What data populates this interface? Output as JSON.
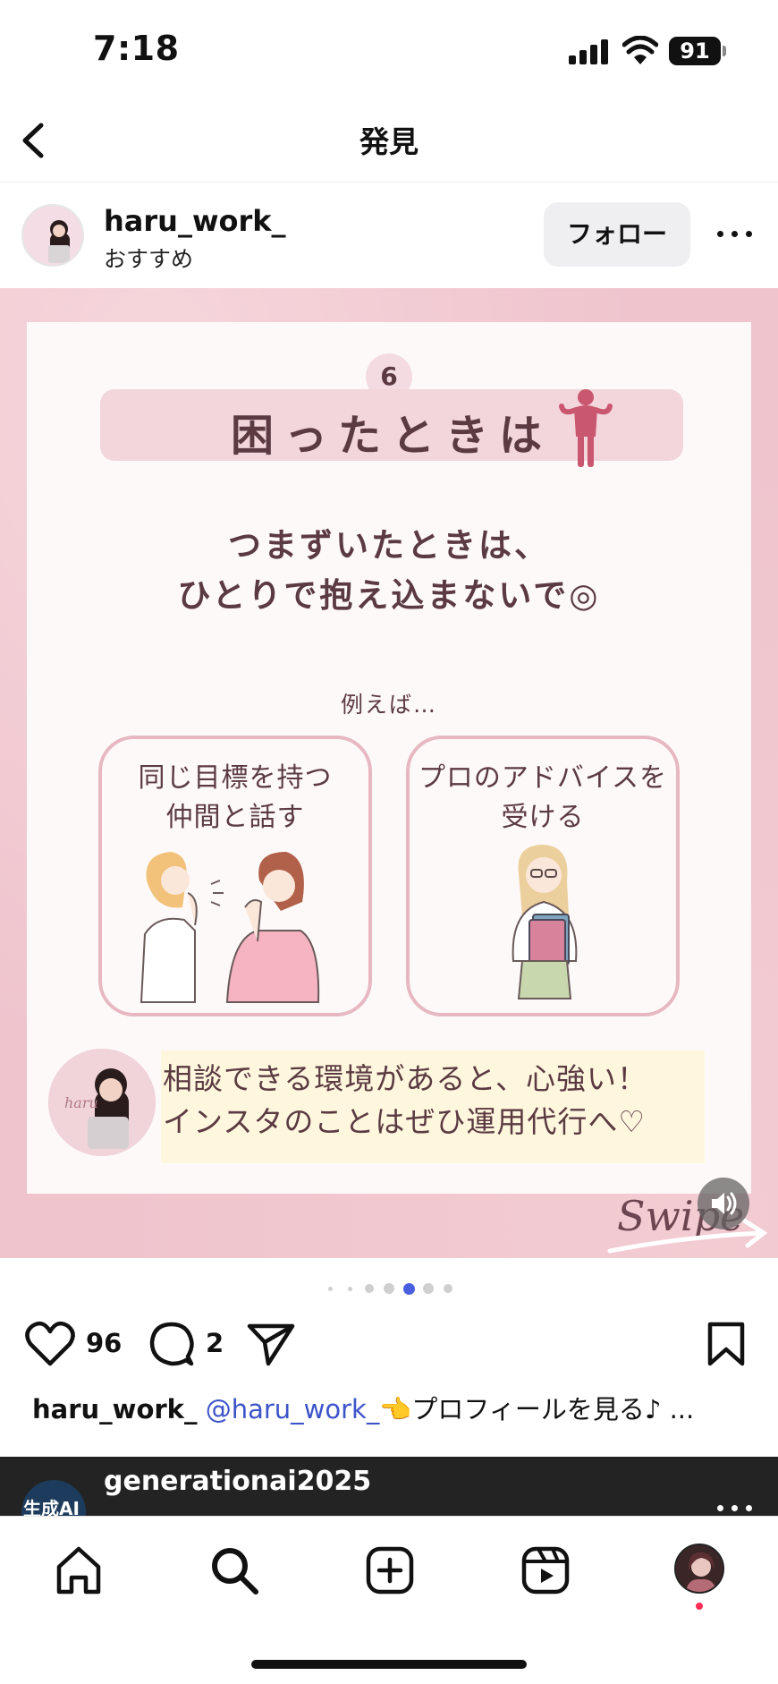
{
  "status": {
    "time": "7:18",
    "battery": "91"
  },
  "nav": {
    "title": "発見"
  },
  "post": {
    "username": "haru_work_",
    "subtitle": "おすすめ",
    "follow_label": "フォロー",
    "slide": {
      "step_number": "6",
      "title": "困ったときは",
      "message_line1": "つまずいたときは、",
      "message_line2": "ひとりで抱え込まないで◎",
      "example_label": "例えば…",
      "option1_line1": "同じ目標を持つ",
      "option1_line2": "仲間と話す",
      "option2_line1": "プロのアドバイスを",
      "option2_line2": "受ける",
      "note_line1": "相談できる環境があると、心強い！",
      "note_line2": "インスタのことはぜひ運用代行へ♡",
      "swipe": "Swipe",
      "avatar_text": "haru"
    },
    "likes": "96",
    "comments": "2",
    "caption_user": "haru_work_",
    "caption_mention": "@haru_work_",
    "caption_text": "👈プロフィールを見る♪ ...",
    "carousel": {
      "count": 7,
      "active_index": 4
    }
  },
  "next_post": {
    "username": "generationai2025",
    "avatar_text": "生成AI"
  },
  "icons": {
    "back": "chevron-left-icon",
    "more": "more-horizontal-icon",
    "like": "heart-icon",
    "comment": "comment-icon",
    "share": "send-icon",
    "save": "bookmark-icon",
    "sound": "speaker-icon",
    "home": "home-icon",
    "search": "search-icon",
    "create": "plus-square-icon",
    "reels": "reels-icon"
  },
  "colors": {
    "accent_mention": "#3d54c9",
    "slide_pink": "#efc4cd",
    "slide_text": "#5b3a42",
    "notification": "#ff2d55"
  }
}
